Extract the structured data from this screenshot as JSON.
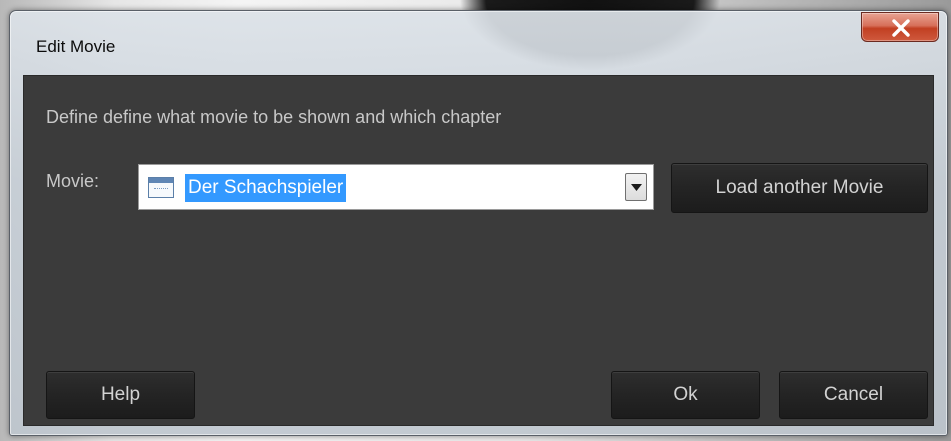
{
  "window": {
    "title": "Edit Movie",
    "close_icon": "close-x-icon"
  },
  "dialog": {
    "description": "Define define what movie to be shown and which chapter",
    "movie_label": "Movie:",
    "movie_select": {
      "selected_value": "Der Schachspieler",
      "item_icon": "movie-file-icon",
      "dropdown_icon": "chevron-down-icon"
    },
    "load_button_label": "Load another Movie"
  },
  "footer": {
    "help_label": "Help",
    "ok_label": "Ok",
    "cancel_label": "Cancel"
  },
  "colors": {
    "client_background": "#3b3b3b",
    "button_background": "#242424",
    "selection_highlight": "#3399ff",
    "close_button": "#c94a2e"
  }
}
